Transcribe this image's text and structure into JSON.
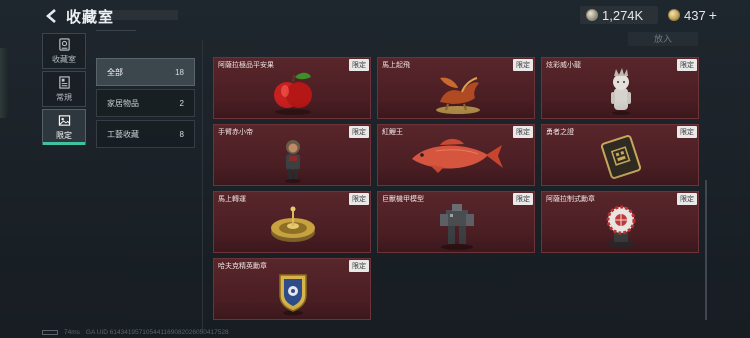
{
  "header": {
    "title": "收藏室",
    "back_icon": "back-arrow-icon",
    "currencies": [
      {
        "icon": "silver-coin-icon",
        "amount": "1,274K"
      },
      {
        "icon": "gold-coin-icon",
        "amount": "437",
        "plus": "+"
      }
    ]
  },
  "top_tab_label": "放入",
  "nav": [
    {
      "label": "收藏室",
      "icon": "collection-icon"
    },
    {
      "label": "常規",
      "icon": "document-icon"
    },
    {
      "label": "限定",
      "icon": "image-icon",
      "active": true
    }
  ],
  "categories": [
    {
      "label": "全部",
      "count": "18",
      "active": true
    },
    {
      "label": "家居物品",
      "count": "2"
    },
    {
      "label": "工藝收藏",
      "count": "8"
    }
  ],
  "badge_label": "限定",
  "items": [
    {
      "name": "阿薩拉極品平安果",
      "art": "apple"
    },
    {
      "name": "馬上起飛",
      "art": "flying-horse"
    },
    {
      "name": "炫彩威小龍",
      "art": "little-dragon"
    },
    {
      "name": "手臂赤小帝",
      "art": "figurine"
    },
    {
      "name": "紅鯉王",
      "art": "red-carp"
    },
    {
      "name": "勇者之證",
      "art": "token-card"
    },
    {
      "name": "馬上轉運",
      "art": "spinning-wheel"
    },
    {
      "name": "巨獸機甲模型",
      "art": "mech-model"
    },
    {
      "name": "阿薩拉制式勳章",
      "art": "red-medal"
    },
    {
      "name": "哈夫克精英勳章",
      "art": "elite-medal"
    }
  ],
  "footer": {
    "ping": "74ms",
    "uid": "GA UID 614341957105441169082026050417528"
  },
  "colors": {
    "card_bg": "#4f2126",
    "accent": "#3fc29f",
    "badge_bg": "#e9e9e9"
  }
}
